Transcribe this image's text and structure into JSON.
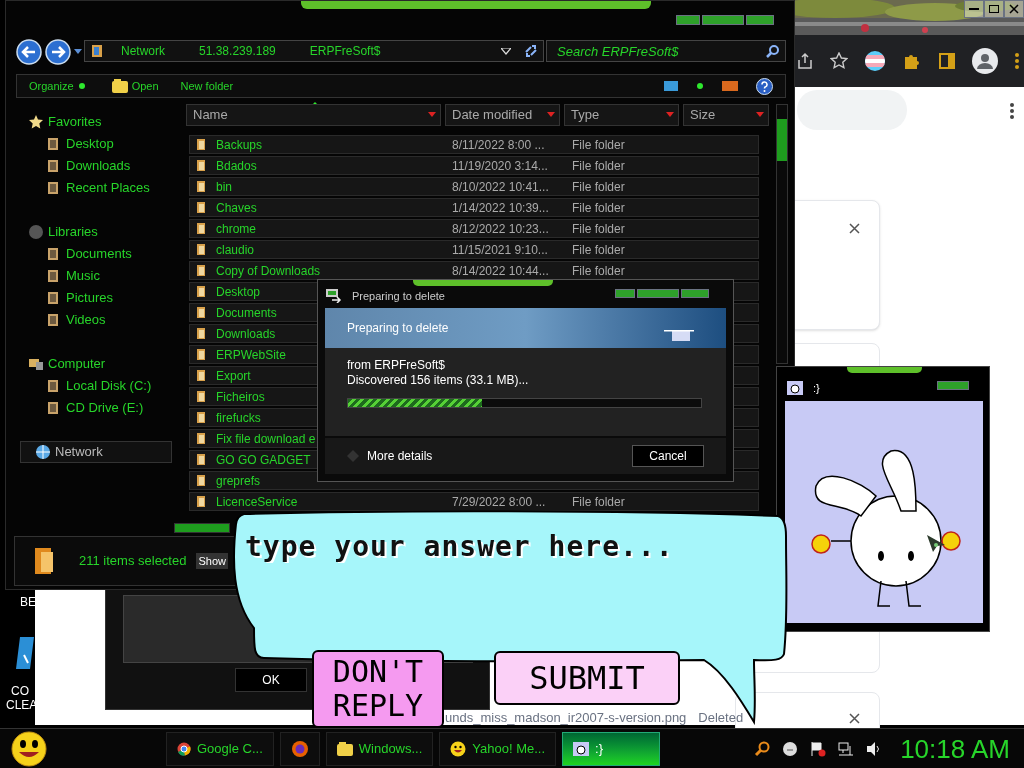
{
  "browser": {
    "file_entry": {
      "name": "unds_miss_madson_ir2007-s-version.png",
      "status": "Deleted"
    }
  },
  "desktop": {
    "icons": [
      {
        "label": "BE"
      },
      {
        "label": "CO CLEA"
      }
    ]
  },
  "explorer": {
    "breadcrumb": [
      "Network",
      "51.38.239.189",
      "ERPFreSoft$"
    ],
    "search": {
      "placeholder": "Search ERPFreSoft$"
    },
    "toolbar": [
      {
        "label": "Organize",
        "kind": "menu"
      },
      {
        "label": "Open",
        "kind": "open"
      },
      {
        "label": "New folder",
        "kind": "plain"
      }
    ],
    "sidebar": [
      {
        "label": "Favorites",
        "kind": "star",
        "children": [
          {
            "label": "Desktop"
          },
          {
            "label": "Downloads"
          },
          {
            "label": "Recent Places"
          }
        ]
      },
      {
        "label": "Libraries",
        "kind": "library",
        "children": [
          {
            "label": "Documents"
          },
          {
            "label": "Music"
          },
          {
            "label": "Pictures"
          },
          {
            "label": "Videos"
          }
        ]
      },
      {
        "label": "Computer",
        "kind": "computer",
        "children": [
          {
            "label": "Local Disk (C:)"
          },
          {
            "label": "CD Drive (E:)"
          }
        ]
      },
      {
        "label": "Network",
        "kind": "network"
      }
    ],
    "columns": [
      "Name",
      "Date modified",
      "Type",
      "Size"
    ],
    "rows": [
      {
        "name": "Backups",
        "date": "8/11/2022 8:00 ...",
        "type": "File folder"
      },
      {
        "name": "Bdados",
        "date": "11/19/2020 3:14...",
        "type": "File folder"
      },
      {
        "name": "bin",
        "date": "8/10/2022 10:41...",
        "type": "File folder"
      },
      {
        "name": "Chaves",
        "date": "1/14/2022 10:39...",
        "type": "File folder"
      },
      {
        "name": "chrome",
        "date": "8/12/2022 10:23...",
        "type": "File folder"
      },
      {
        "name": "claudio",
        "date": "11/15/2021 9:10...",
        "type": "File folder"
      },
      {
        "name": "Copy of Downloads",
        "date": "8/14/2022 10:44...",
        "type": "File folder"
      },
      {
        "name": "Desktop"
      },
      {
        "name": "Documents"
      },
      {
        "name": "Downloads"
      },
      {
        "name": "ERPWebSite"
      },
      {
        "name": "Export"
      },
      {
        "name": "Ficheiros"
      },
      {
        "name": "firefucks"
      },
      {
        "name": "Fix file download e"
      },
      {
        "name": "GO GO GADGET"
      },
      {
        "name": "greprefs"
      },
      {
        "name": "LicenceService",
        "date": "7/29/2022 8:00 ...",
        "type": "File folder"
      }
    ],
    "status": {
      "text": "211 items selected",
      "extra": "Show"
    }
  },
  "dialog": {
    "title": "Preparing to delete",
    "heading": "Preparing to delete",
    "lines": [
      "from ERPFreSoft$",
      "Discovered 156 items (33.1 MB)..."
    ],
    "progress": {
      "level": 0.38
    },
    "details": "More details",
    "cancel": "Cancel"
  },
  "back_dialog": {
    "ok": "OK"
  },
  "bunny_window": {
    "title": ":}"
  },
  "bubble": {
    "placeholder": "type your answer here...",
    "buttons": [
      "DON'T REPLY",
      "SUBMIT"
    ]
  },
  "taskbar": {
    "items": [
      {
        "label": "Google C...",
        "kind": "chrome",
        "selected": false
      },
      {
        "kind": "firefox",
        "selected": false
      },
      {
        "label": "Windows...",
        "kind": "folder",
        "selected": false
      },
      {
        "label": "Yahoo! Me...",
        "kind": "smiley",
        "selected": false
      },
      {
        "label": ":}",
        "kind": "bunny",
        "selected": true
      }
    ],
    "clock": "10:18 AM"
  }
}
